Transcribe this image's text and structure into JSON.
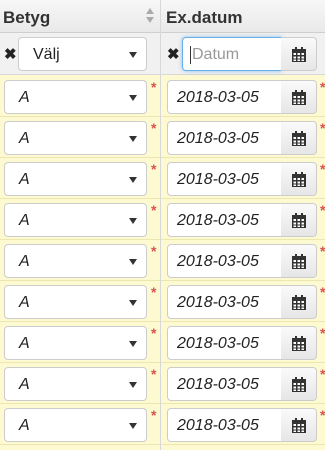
{
  "columns": [
    {
      "header": "Betyg"
    },
    {
      "header": "Ex.datum"
    }
  ],
  "filters": {
    "betyg_select": "Välj",
    "date_placeholder": "Datum"
  },
  "required_mark": "*",
  "rows": [
    {
      "grade": "A",
      "date": "2018-03-05"
    },
    {
      "grade": "A",
      "date": "2018-03-05"
    },
    {
      "grade": "A",
      "date": "2018-03-05"
    },
    {
      "grade": "A",
      "date": "2018-03-05"
    },
    {
      "grade": "A",
      "date": "2018-03-05"
    },
    {
      "grade": "A",
      "date": "2018-03-05"
    },
    {
      "grade": "A",
      "date": "2018-03-05"
    },
    {
      "grade": "A",
      "date": "2018-03-05"
    },
    {
      "grade": "A",
      "date": "2018-03-05"
    }
  ],
  "colors": {
    "row_background": "#fdfad2",
    "required": "#d9534f",
    "focus": "#66afe9"
  }
}
